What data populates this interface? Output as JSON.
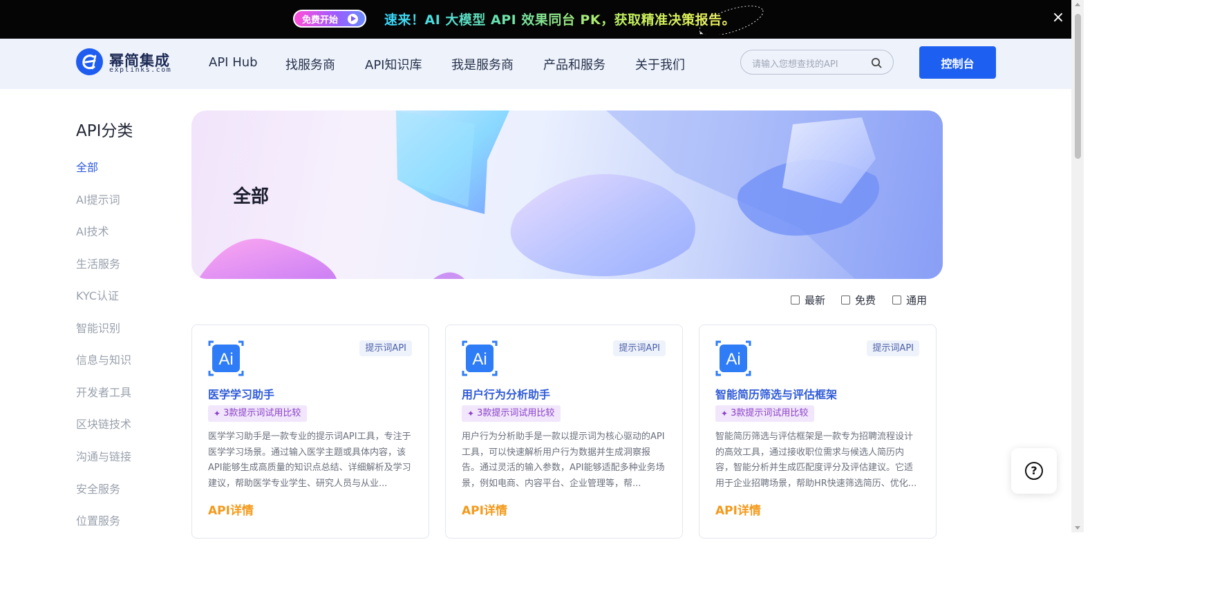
{
  "promo": {
    "button_label": "免费开始",
    "text": "速来！AI 大模型 API 效果同台 PK，获取精准决策报告。",
    "close_icon": "×"
  },
  "header": {
    "logo_name": "幂简集成",
    "logo_sub": "explinks.com",
    "nav": [
      "API Hub",
      "找服务商",
      "API知识库",
      "我是服务商",
      "产品和服务",
      "关于我们"
    ],
    "search_placeholder": "请输入您想查找的API",
    "console_label": "控制台"
  },
  "sidebar": {
    "title": "API分类",
    "items": [
      "全部",
      "AI提示词",
      "AI技术",
      "生活服务",
      "KYC认证",
      "智能识别",
      "信息与知识",
      "开发者工具",
      "区块链技术",
      "沟通与链接",
      "安全服务",
      "位置服务"
    ],
    "active_index": 0
  },
  "banner": {
    "title": "全部"
  },
  "filters": [
    "最新",
    "免费",
    "通用"
  ],
  "cards": [
    {
      "icon": "ai-icon",
      "tag": "提示词API",
      "title": "医学学习助手",
      "badge": "3款提示词试用比较",
      "desc": "医学学习助手是一款专业的提示词API工具，专注于医学学习场景。通过输入医学主题或具体内容，该API能够生成高质量的知识点总结、详细解析及学习建议，帮助医学专业学生、研究人员与从业...",
      "link": "API详情"
    },
    {
      "icon": "ai-icon",
      "tag": "提示词API",
      "title": "用户行为分析助手",
      "badge": "3款提示词试用比较",
      "desc": "用户行为分析助手是一款以提示词为核心驱动的API工具，可以快速解析用户行为数据并生成洞察报告。通过灵活的输入参数，API能够适配多种业务场景，例如电商、内容平台、企业管理等，帮...",
      "link": "API详情"
    },
    {
      "icon": "ai-icon",
      "tag": "提示词API",
      "title": "智能简历筛选与评估框架",
      "badge": "3款提示词试用比较",
      "desc": "智能简历筛选与评估框架是一款专为招聘流程设计的高效工具，通过接收职位需求与候选人简历内容，智能分析并生成匹配度评分及评估建议。它适用于企业招聘场景，帮助HR快速筛选简历、优化...",
      "link": "API详情"
    }
  ],
  "help": {
    "icon": "help-icon",
    "glyph": "?"
  },
  "colors": {
    "accent": "#1d5ff0",
    "link": "#f39a1b",
    "title_blue": "#2f5bd8",
    "badge_purple": "#8a3fc8"
  }
}
